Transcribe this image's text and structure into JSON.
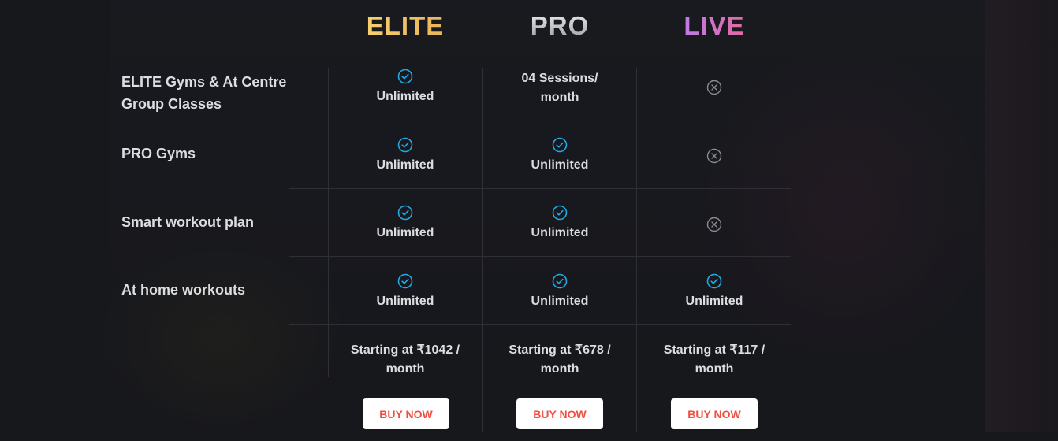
{
  "plans": {
    "elite": {
      "name": "ELITE",
      "price": "Starting at ₹1042 / month",
      "buy_label": "BUY NOW"
    },
    "pro": {
      "name": "PRO",
      "price": "Starting at ₹678 / month",
      "buy_label": "BUY NOW"
    },
    "live": {
      "name": "LIVE",
      "price": "Starting at ₹117 / month",
      "buy_label": "BUY NOW"
    }
  },
  "features": [
    {
      "label": "ELITE Gyms & At Centre Group Classes",
      "elite": {
        "icon": "check-circle-icon",
        "text": "Unlimited"
      },
      "pro": {
        "icon": "",
        "text": "04 Sessions/ month"
      },
      "live": {
        "icon": "x-circle-icon",
        "text": ""
      }
    },
    {
      "label": "PRO Gyms",
      "elite": {
        "icon": "check-circle-icon",
        "text": "Unlimited"
      },
      "pro": {
        "icon": "check-circle-icon",
        "text": "Unlimited"
      },
      "live": {
        "icon": "x-circle-icon",
        "text": ""
      }
    },
    {
      "label": "Smart workout plan",
      "elite": {
        "icon": "check-circle-icon",
        "text": "Unlimited"
      },
      "pro": {
        "icon": "check-circle-icon",
        "text": "Unlimited"
      },
      "live": {
        "icon": "x-circle-icon",
        "text": ""
      }
    },
    {
      "label": "At home workouts",
      "elite": {
        "icon": "check-circle-icon",
        "text": "Unlimited"
      },
      "pro": {
        "icon": "check-circle-icon",
        "text": "Unlimited"
      },
      "live": {
        "icon": "check-circle-icon",
        "text": "Unlimited"
      }
    }
  ],
  "colors": {
    "background": "#17181c",
    "elite_title": "#f2c46a",
    "pro_title": "#c9cacf",
    "live_title": "#d86fc9",
    "check_icon": "#1fa9e6",
    "cross_icon": "#8a8b90",
    "buy_text": "#ef4f43",
    "divider": "#2f3037"
  }
}
